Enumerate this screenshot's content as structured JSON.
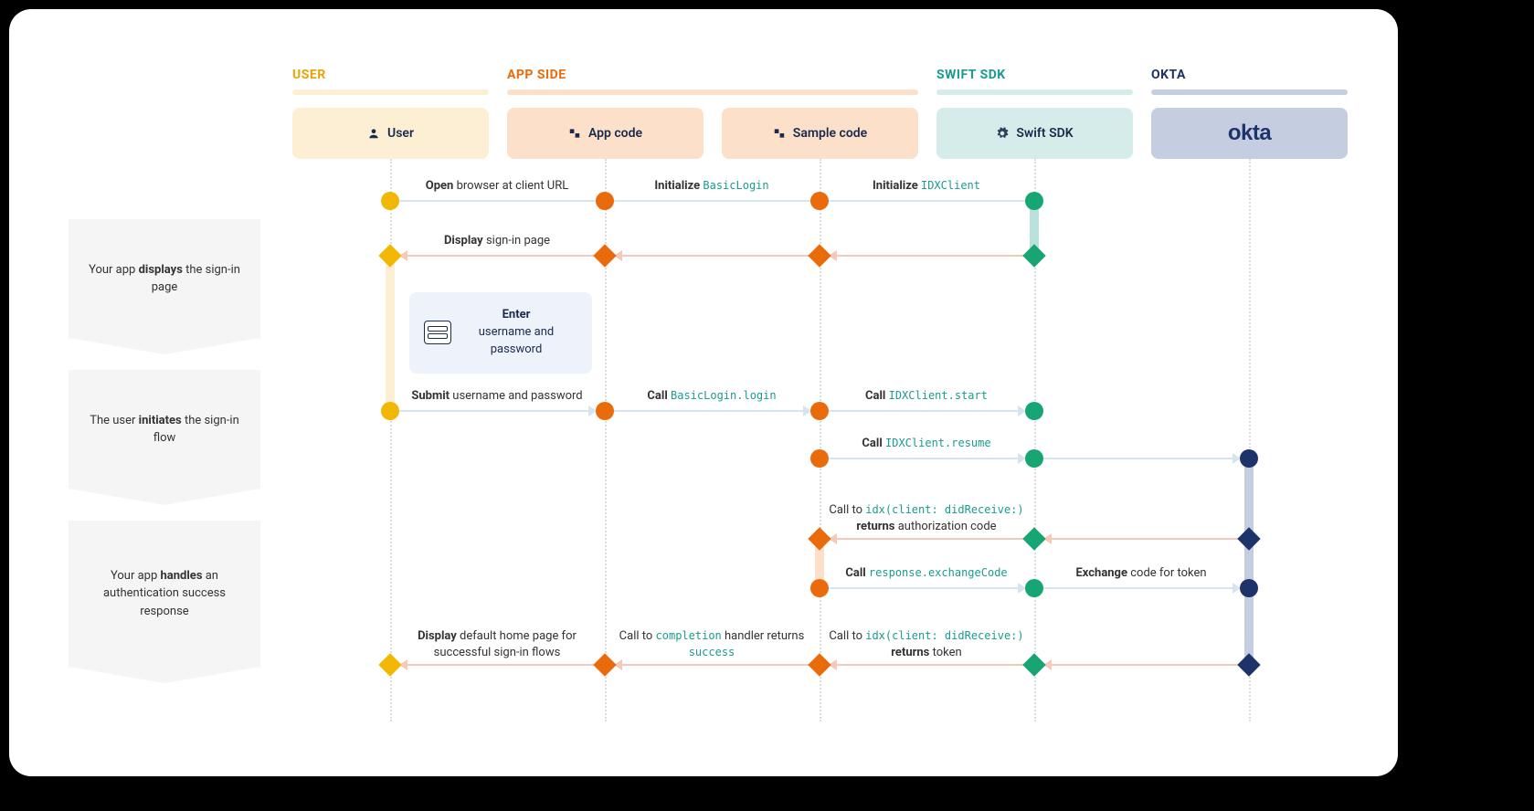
{
  "sections": {
    "user": {
      "label": "USER",
      "color": "#e8a202",
      "barBg": "#fdefd3"
    },
    "app": {
      "label": "APP SIDE",
      "color": "#ea6b0c",
      "barBg": "#fce0c9"
    },
    "sdk": {
      "label": "SWIFT SDK",
      "color": "#1a9b8f",
      "barBg": "#d6ecea"
    },
    "okta": {
      "label": "OKTA",
      "color": "#1e3369",
      "barBg": "#c5cde1"
    }
  },
  "lanes": {
    "user": {
      "title": "User",
      "bg": "#fdefd3"
    },
    "app": {
      "title": "App code",
      "bg": "#fce0c9"
    },
    "sample": {
      "title": "Sample code",
      "bg": "#fce0c9"
    },
    "sdk": {
      "title": "Swift SDK",
      "bg": "#d6ecea"
    },
    "okta": {
      "title": "okta",
      "bg": "#c5cde1"
    }
  },
  "phases": {
    "p1": "Your app <b>displays</b> the sign-in page",
    "p2": "The user <b>initiates</b> the sign-in flow",
    "p3": "Your app <b>handles</b> an authentication success response"
  },
  "callout": {
    "bold": "Enter",
    "rest": "username and password"
  },
  "messages": {
    "m1": "<b>Open</b> browser at client URL",
    "m2": "<b>Initialize</b> <span class='code'>BasicLogin</span>",
    "m3": "<b>Initialize</b> <span class='code'>IDXClient</span>",
    "m4": "<b>Display</b> sign-in page",
    "m5": "<b>Submit</b> username and password",
    "m6": "<b>Call</b> <span class='code'>BasicLogin.login</span>",
    "m7": "<b>Call</b> <span class='code'>IDXClient.start</span>",
    "m8": "<b>Call</b> <span class='code'>IDXClient.resume</span>",
    "m9": "Call to <span class='code'>idx(client: didReceive:)</span><br><b>returns</b> authorization code",
    "m10": "<b>Call</b> <span class='code'>response.exchangeCode</span>",
    "m11": "<b>Exchange</b> code for token",
    "m12": "Call to <span class='code'>idx(client: didReceive:)</span><br><b>returns</b> token",
    "m13": "Call to <span class='code'>completion</span> handler returns<br><span class='code'>success</span>",
    "m14": "<b>Display</b> default home page for<br>successful sign-in flows"
  },
  "colors": {
    "yellow": "#f2b705",
    "orange": "#ea6b0c",
    "green": "#17a673",
    "navy": "#1e3369",
    "arrowFwd": "#d6e3f0",
    "arrowBack": "#f5c9b8"
  }
}
